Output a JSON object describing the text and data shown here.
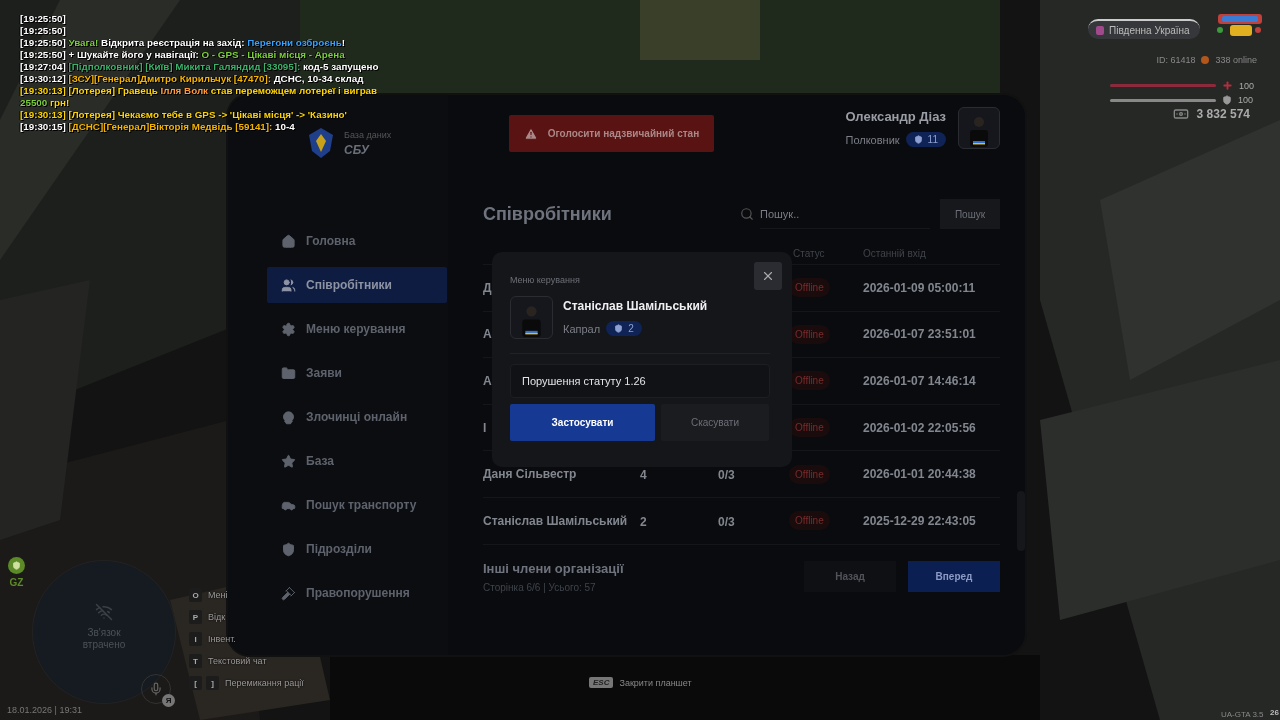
{
  "chat": [
    {
      "segments": [
        {
          "text": "[19:25:50]",
          "color": "#ffffff"
        }
      ]
    },
    {
      "segments": [
        {
          "text": "[19:25:50]",
          "color": "#ffffff"
        }
      ]
    },
    {
      "segments": [
        {
          "text": "[19:25:50] ",
          "color": "#ffffff"
        },
        {
          "text": "Увага!",
          "color": "#7ccf3c"
        },
        {
          "text": " Відкрита реєстрація на захід: ",
          "color": "#ffffff"
        },
        {
          "text": "Перегони озброєнь",
          "color": "#35a2ff"
        },
        {
          "text": "!",
          "color": "#ffffff"
        }
      ]
    },
    {
      "segments": [
        {
          "text": "[19:25:50] +  Шукайте його у навігації: ",
          "color": "#ffffff"
        },
        {
          "text": "O - GPS - Цікаві місця - Арена",
          "color": "#7ccf3c"
        }
      ]
    },
    {
      "segments": [
        {
          "text": "[19:27:04] ",
          "color": "#ffffff"
        },
        {
          "text": "[Підполковник] [Київ]  Микита Галяндид [33095]:",
          "color": "#3cb36a"
        },
        {
          "text": " код-5 запущено",
          "color": "#ffffff"
        }
      ]
    },
    {
      "segments": [
        {
          "text": "[19:30:12] ",
          "color": "#ffffff"
        },
        {
          "text": "[ЗСУ][Генерал]Дмитро Кирильчук [47470]:",
          "color": "#f5b400"
        },
        {
          "text": " ДСНС, 10-34 склад",
          "color": "#ffffff"
        }
      ]
    },
    {
      "segments": [
        {
          "text": "[19:30:13] [Лотерея] Гравець ",
          "color": "#ffd400"
        },
        {
          "text": "Ілля Волк",
          "color": "#ff9a3c"
        },
        {
          "text": " став переможцем лотереї і виграв ",
          "color": "#ffd400"
        },
        {
          "text": "25500",
          "color": "#7ccf3c"
        },
        {
          "text": " грн!",
          "color": "#ffd400"
        }
      ]
    },
    {
      "segments": [
        {
          "text": "[19:30:13] [Лотерея] Чекаємо тебе в GPS -> 'Цікаві місця' -> 'Казино'",
          "color": "#ffd400"
        }
      ]
    },
    {
      "segments": [
        {
          "text": "[19:30:15] ",
          "color": "#ffffff"
        },
        {
          "text": "[ДСНС][Генерал]Вікторія Медвідь [59141]:",
          "color": "#f5b400"
        },
        {
          "text": " 10-4",
          "color": "#ffffff"
        }
      ]
    }
  ],
  "server": {
    "name": "Південна Україна",
    "player_id": "ID: 61418",
    "online": "338 online"
  },
  "stats": {
    "health": {
      "level": 1,
      "reading": "100"
    },
    "armor": {
      "level": 1,
      "reading": "100"
    },
    "money": "3 832 574"
  },
  "tablet": {
    "brand": {
      "subtitle": "База даних",
      "title": "СБУ"
    },
    "sidebar": {
      "items": [
        {
          "label": "Головна",
          "kind": "home",
          "selected": false
        },
        {
          "label": "Співробітники",
          "kind": "users",
          "selected": true
        },
        {
          "label": "Меню керування",
          "kind": "settings",
          "selected": false
        },
        {
          "label": "Заяви",
          "kind": "folder",
          "selected": false
        },
        {
          "label": "Злочинці онлайн",
          "kind": "criminals",
          "selected": false
        },
        {
          "label": "База",
          "kind": "star",
          "selected": false
        },
        {
          "label": "Пошук транспорту",
          "kind": "car",
          "selected": false
        },
        {
          "label": "Підрозділи",
          "kind": "shield",
          "selected": false
        },
        {
          "label": "Правопорушення",
          "kind": "gavel",
          "selected": false
        }
      ]
    },
    "emergency_button": "Оголосити надзвичайний стан",
    "user": {
      "name": "Олександр Діаз",
      "rank": "Полковник",
      "rank_level": "11"
    },
    "page_title": "Співробітники",
    "search": {
      "placeholder": "Пошук..",
      "button": "Пошук"
    },
    "table": {
      "columns": [
        "Статус",
        "Останній вхід"
      ],
      "rows": [
        {
          "name": "Д",
          "status": "Offline",
          "last_login": "2026-01-09 05:00:11"
        },
        {
          "name": "А",
          "status": "Offline",
          "last_login": "2026-01-07 23:51:01"
        },
        {
          "name": "А",
          "status": "Offline",
          "last_login": "2026-01-07 14:46:14"
        },
        {
          "name": "І",
          "status": "Offline",
          "last_login": "2026-01-02 22:05:56"
        },
        {
          "name": "Даня Сільвестр",
          "rank": "4",
          "warnings": "0/3",
          "status": "Offline",
          "last_login": "2026-01-01 20:44:38"
        },
        {
          "name": "Станіслав Шамільський",
          "rank": "2",
          "warnings": "0/3",
          "status": "Offline",
          "last_login": "2025-12-29 22:43:05"
        }
      ]
    },
    "footer": {
      "title": "Інші члени організації",
      "summary": "Сторінка 6/6 | Усього: 57",
      "buttons": [
        {
          "label": "Назад",
          "kind": "secondary"
        },
        {
          "label": "Вперед",
          "kind": "primary"
        }
      ]
    },
    "modal": {
      "title": "Меню керування",
      "name": "Станіслав Шамільський",
      "rank": "Капрал",
      "rank_level": "2",
      "reason": "Порушення статуту 1.26",
      "buttons": [
        {
          "label": "Застосувати",
          "kind": "primary"
        },
        {
          "label": "Скасувати",
          "kind": "secondary"
        }
      ]
    }
  },
  "hud": {
    "zone": "GZ",
    "map_status": "Зв'язок втрачено",
    "voice_badge": "Я",
    "hints": [
      {
        "keys": [
          "O"
        ],
        "label": "Мені"
      },
      {
        "keys": [
          "P"
        ],
        "label": "Відк"
      },
      {
        "keys": [
          "I"
        ],
        "label": "Інвент."
      },
      {
        "keys": [
          "T"
        ],
        "label": "Текстовий чат"
      },
      {
        "keys": [
          "[",
          "]"
        ],
        "label": "Перемикання рації"
      }
    ],
    "datetime": "18.01.2026 | 19:31"
  },
  "close_hint": {
    "key": "ESC",
    "label": "Закрити планшет"
  },
  "version": "UA-GTA 3.5",
  "corner": "26"
}
